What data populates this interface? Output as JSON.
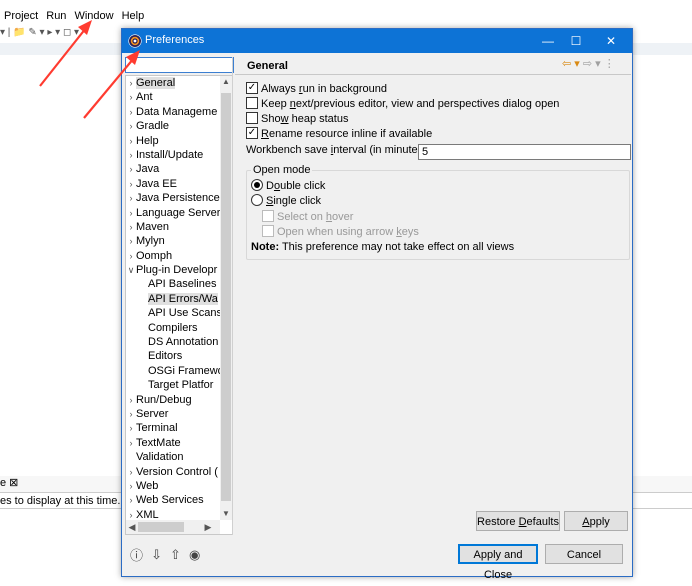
{
  "background": {
    "menu": [
      "Project",
      "Run",
      "Window",
      "Help"
    ],
    "panel_tab": "e ⊠",
    "panel_text": "es to display at this time."
  },
  "dialog": {
    "title": "Preferences",
    "controls": {
      "minimize": "—",
      "maximize": "☐",
      "close": "✕"
    },
    "filter": {
      "value": "",
      "placeholder": ""
    },
    "tree": [
      {
        "label": "General",
        "kind": "collapsed",
        "selected": true
      },
      {
        "label": "Ant",
        "kind": "collapsed"
      },
      {
        "label": "Data Manageme",
        "kind": "collapsed"
      },
      {
        "label": "Gradle",
        "kind": "collapsed"
      },
      {
        "label": "Help",
        "kind": "collapsed"
      },
      {
        "label": "Install/Update",
        "kind": "collapsed"
      },
      {
        "label": "Java",
        "kind": "collapsed"
      },
      {
        "label": "Java EE",
        "kind": "collapsed"
      },
      {
        "label": "Java Persistence",
        "kind": "collapsed"
      },
      {
        "label": "Language Server",
        "kind": "collapsed"
      },
      {
        "label": "Maven",
        "kind": "collapsed"
      },
      {
        "label": "Mylyn",
        "kind": "collapsed"
      },
      {
        "label": "Oomph",
        "kind": "collapsed"
      },
      {
        "label": "Plug-in Developr",
        "kind": "expanded"
      },
      {
        "label": "API Baselines",
        "kind": "child"
      },
      {
        "label": "API Errors/Wa",
        "kind": "child",
        "selected": true
      },
      {
        "label": "API Use Scans",
        "kind": "child"
      },
      {
        "label": "Compilers",
        "kind": "child"
      },
      {
        "label": "DS Annotation",
        "kind": "child"
      },
      {
        "label": "Editors",
        "kind": "child"
      },
      {
        "label": "OSGi Framewo",
        "kind": "child"
      },
      {
        "label": "Target Platfor",
        "kind": "child"
      },
      {
        "label": "Run/Debug",
        "kind": "collapsed"
      },
      {
        "label": "Server",
        "kind": "collapsed"
      },
      {
        "label": "Terminal",
        "kind": "collapsed"
      },
      {
        "label": "TextMate",
        "kind": "collapsed"
      },
      {
        "label": "Validation",
        "kind": "leaf"
      },
      {
        "label": "Version Control (",
        "kind": "collapsed"
      },
      {
        "label": "Web",
        "kind": "collapsed"
      },
      {
        "label": "Web Services",
        "kind": "collapsed"
      },
      {
        "label": "XML",
        "kind": "collapsed"
      }
    ],
    "page": {
      "title": "General",
      "options": {
        "run_background": {
          "pre": "Always ",
          "u": "r",
          "post": "un in background",
          "checked": true
        },
        "keep_next_prev": {
          "pre": "Keep ",
          "u": "n",
          "post": "ext/previous editor, view and perspectives dialog open",
          "checked": false
        },
        "show_heap": {
          "pre": "Sho",
          "u": "w",
          "post": " heap status",
          "checked": false
        },
        "rename_inline": {
          "pre": "",
          "u": "R",
          "post": "ename resource inline if available",
          "checked": true
        }
      },
      "interval": {
        "pre": "Workbench save ",
        "u": "i",
        "post": "nterval (in minutes):",
        "value": "5"
      },
      "open_mode": {
        "label": "Open mode",
        "double_click": {
          "pre": "D",
          "u": "o",
          "post": "uble click",
          "selected": true
        },
        "single_click": {
          "pre": "",
          "u": "S",
          "post": "ingle click",
          "selected": false
        },
        "select_hover": {
          "pre": "Select on ",
          "u": "h",
          "post": "over",
          "checked": false
        },
        "open_arrow": {
          "pre": "Open when using arrow ",
          "u": "k",
          "post": "eys",
          "checked": false
        }
      },
      "note": {
        "bold": "Note:",
        "text": " This preference may not take effect on all views"
      }
    },
    "buttons": {
      "restore_defaults": {
        "pre": "Restore ",
        "u": "D",
        "post": "efaults"
      },
      "apply": {
        "pre": "",
        "u": "A",
        "post": "pply"
      },
      "apply_close": "Apply and Close",
      "cancel": "Cancel"
    }
  }
}
